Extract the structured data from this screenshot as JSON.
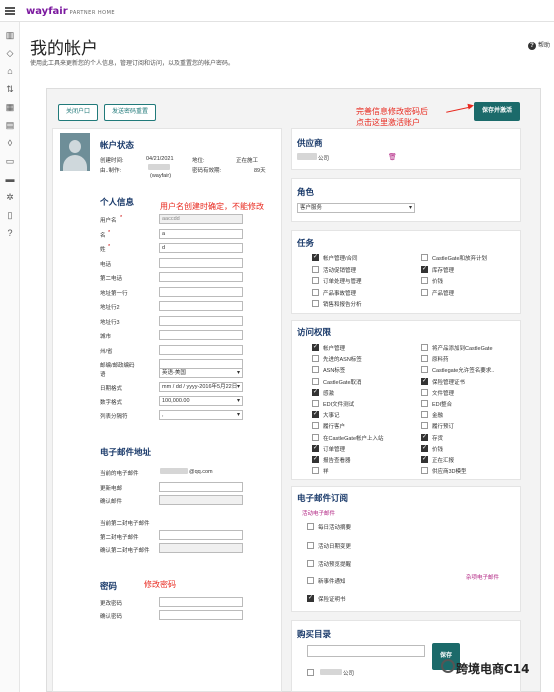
{
  "brand": {
    "name": "wayfair",
    "tag": "PARTNER HOME"
  },
  "page": {
    "title": "我的帐户",
    "subtitle": "使用此工具来更新您的个人信息，管理订阅和访问，以及重置您的帐户密码。",
    "help": "帮助"
  },
  "buttons": {
    "close": "关闭户口",
    "resend": "发送密码重置",
    "save": "保存并激活"
  },
  "annotations": {
    "save_hint_1": "完善信息修改密码后",
    "save_hint_2": "点击这里激活账户",
    "username_hint": "用户名创建时确定，不能修改",
    "password_hint": "修改密码",
    "watermark": "跨境电商C14"
  },
  "status": {
    "title": "帐户状态",
    "created_label": "创建时间:",
    "created_value": "04/21/2021",
    "location_label": "地位:",
    "location_value": "正在施工",
    "creator_label": "由..制作:",
    "creator_value": "(wayfair)",
    "expire_label": "密码有效期:",
    "expire_value": "89天"
  },
  "personal": {
    "title": "个人信息",
    "fields": [
      {
        "label": "用户名",
        "req": "*",
        "value": "aaccdd"
      },
      {
        "label": "名",
        "req": "*",
        "value": "a"
      },
      {
        "label": "姓",
        "req": "*",
        "value": "d"
      },
      {
        "label": "电话",
        "req": "",
        "value": ""
      },
      {
        "label": "第二电话",
        "req": "",
        "value": ""
      },
      {
        "label": "地址第一行",
        "req": "",
        "value": ""
      },
      {
        "label": "地址行2",
        "req": "",
        "value": ""
      },
      {
        "label": "地址行3",
        "req": "",
        "value": ""
      },
      {
        "label": "城市",
        "req": "",
        "value": ""
      },
      {
        "label": "州/省",
        "req": "",
        "value": ""
      },
      {
        "label": "邮编/邮政编码",
        "req": "",
        "value": ""
      }
    ],
    "selects": [
      {
        "label": "语",
        "value": "英语-美国"
      },
      {
        "label": "日期格式",
        "value": "mm / dd / yyyy-2016年5月22日"
      },
      {
        "label": "数字格式",
        "value": "100,000.00"
      },
      {
        "label": "列表分隔符",
        "value": ","
      }
    ]
  },
  "email": {
    "title": "电子邮件地址",
    "current_label": "当前的电子邮件",
    "current_value": "@qq.com",
    "update_label": "更新电邮",
    "confirm_label": "确认邮件",
    "second_label": "当前第二封电子邮件",
    "second_update_label": "第二封电子邮件",
    "second_confirm_label": "确认第二封电子邮件"
  },
  "password": {
    "title": "密码",
    "change_label": "更改密码",
    "confirm_label": "确认密码"
  },
  "supplier": {
    "title": "供应商",
    "value": "公司"
  },
  "role": {
    "title": "角色",
    "value": "客户服务"
  },
  "tasks": {
    "title": "任务",
    "items": [
      {
        "label": "帐户管理/合同",
        "on": true
      },
      {
        "label": "CastleGate和放弃计划",
        "on": false
      },
      {
        "label": "活动促销管理",
        "on": false
      },
      {
        "label": "库存管理",
        "on": true
      },
      {
        "label": "订单处理与管理",
        "on": false
      },
      {
        "label": "价钱",
        "on": false
      },
      {
        "label": "产品事故管理",
        "on": false
      },
      {
        "label": "产品管理",
        "on": false
      },
      {
        "label": "销售和报告分析",
        "on": false
      }
    ]
  },
  "access": {
    "title": "访问权限",
    "items": [
      {
        "label": "帐户管理",
        "on": true
      },
      {
        "label": "将产品添加到CastleGate",
        "on": false
      },
      {
        "label": "先进的ASN标签",
        "on": false
      },
      {
        "label": "原料药",
        "on": false
      },
      {
        "label": "ASN标签",
        "on": false
      },
      {
        "label": "Castlegate允许签名要求..",
        "on": false
      },
      {
        "label": "CastleGate取消",
        "on": false
      },
      {
        "label": "保险管理证书",
        "on": true
      },
      {
        "label": "感激",
        "on": true
      },
      {
        "label": "文件管理",
        "on": false
      },
      {
        "label": "EDI文件测试",
        "on": false
      },
      {
        "label": "EDI整合",
        "on": false
      },
      {
        "label": "大事记",
        "on": true
      },
      {
        "label": "金融",
        "on": false
      },
      {
        "label": "履行客户",
        "on": false
      },
      {
        "label": "履行预订",
        "on": false
      },
      {
        "label": "在CastleGate帐户上入站",
        "on": false
      },
      {
        "label": "存货",
        "on": true
      },
      {
        "label": "订单管理",
        "on": true
      },
      {
        "label": "价钱",
        "on": true
      },
      {
        "label": "报告查看器",
        "on": true
      },
      {
        "label": "正在汇报",
        "on": true
      },
      {
        "label": "祥",
        "on": false
      },
      {
        "label": "供应商3D模型",
        "on": false
      }
    ]
  },
  "subscriptions": {
    "title": "电子邮件订阅",
    "event_header": "活动电子邮件",
    "misc_header": "杂项电子邮件",
    "items": [
      {
        "label": "每日活动摘要",
        "on": false
      },
      {
        "label": "活动日期变更",
        "on": false
      },
      {
        "label": "活动预览提醒",
        "on": false
      },
      {
        "label": "新事件通知",
        "on": false
      },
      {
        "label": "保险证明书",
        "on": true
      }
    ]
  },
  "catalog": {
    "title": "购买目录",
    "button": "保存",
    "row": "公司"
  }
}
